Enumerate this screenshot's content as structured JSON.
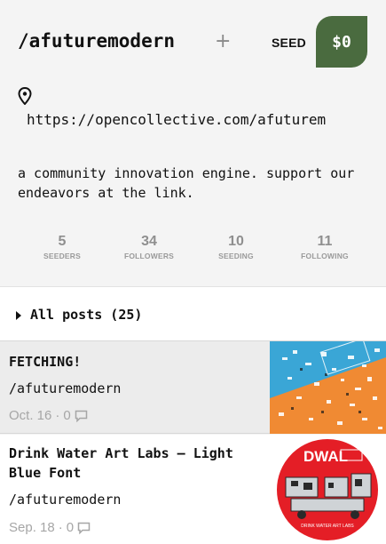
{
  "profile": {
    "handle": "/afuturemodern",
    "plus_icon": "plus-icon",
    "seed_label": "SEED",
    "seed_amount": "$0",
    "link": "https://opencollective.com/afuturem",
    "bio": "a community innovation engine. support our endeavors at the link."
  },
  "stats": [
    {
      "value": "5",
      "label": "SEEDERS"
    },
    {
      "value": "34",
      "label": "FOLLOWERS"
    },
    {
      "value": "10",
      "label": "SEEDING"
    },
    {
      "value": "11",
      "label": "FOLLOWING"
    }
  ],
  "filter": {
    "label": "All posts (25)"
  },
  "posts": [
    {
      "title": "FETCHING!",
      "author": "/afuturemodern",
      "date": "Oct. 16",
      "comments": "0"
    },
    {
      "title": "Drink Water Art Labs – Light Blue Font",
      "author": "/afuturemodern",
      "date": "Sep. 18",
      "comments": "0"
    }
  ],
  "thumb2_text": {
    "brand": "DWAL",
    "sub": "DRINK WATER ART LABS"
  },
  "colors": {
    "seed_button": "#4a6b3f",
    "thumb1_blue": "#3aa6d6",
    "thumb1_orange": "#f08a33",
    "thumb2_red": "#e41e26"
  }
}
